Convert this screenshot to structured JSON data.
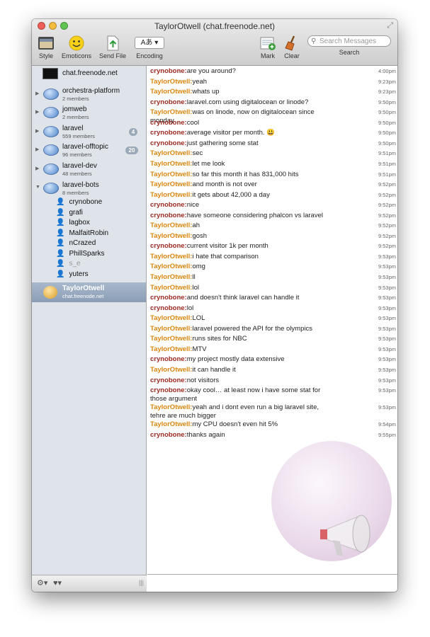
{
  "window": {
    "title": "TaylorOtwell (chat.freenode.net)"
  },
  "toolbar": {
    "style_label": "Style",
    "emoticons_label": "Emoticons",
    "send_file_label": "Send File",
    "encoding_label": "Encoding",
    "encoding_value": "Aあ ▾",
    "mark_label": "Mark",
    "clear_label": "Clear",
    "search_placeholder": "Search Messages",
    "search_label": "Search"
  },
  "sidebar": {
    "server": "chat.freenode.net",
    "channels": [
      {
        "name": "orchestra-platform",
        "members": "2 members",
        "badge": ""
      },
      {
        "name": "jomweb",
        "members": "2 members",
        "badge": ""
      },
      {
        "name": "laravel",
        "members": "559 members",
        "badge": "4"
      },
      {
        "name": "laravel-offtopic",
        "members": "96 members",
        "badge": "20"
      },
      {
        "name": "laravel-dev",
        "members": "48 members",
        "badge": ""
      },
      {
        "name": "laravel-bots",
        "members": "8 members",
        "badge": ""
      }
    ],
    "member_list": [
      "crynobone",
      "grafi",
      "lagbox",
      "MalfaitRobin",
      "nCrazed",
      "PhillSparks",
      "s_e",
      "yuters"
    ],
    "selected": {
      "name": "TaylorOtwell",
      "server": "chat.freenode.net"
    }
  },
  "messages": [
    {
      "nick": "crynobone:",
      "text": "are you around?",
      "time": "4:00pm"
    },
    {
      "nick": "TaylorOtwell:",
      "text": "yeah",
      "time": "9:23pm"
    },
    {
      "nick": "TaylorOtwell:",
      "text": "whats up",
      "time": "9:23pm"
    },
    {
      "nick": "crynobone:",
      "text": "laravel.com using digitalocean or linode?",
      "time": "9:50pm"
    },
    {
      "nick": "TaylorOtwell:",
      "text": "was on linode, now on digitalocean since monday",
      "time": "9:50pm"
    },
    {
      "nick": "crynobone:",
      "text": "cool",
      "time": "9:50pm"
    },
    {
      "nick": "crynobone:",
      "text": "average visitor per month.",
      "time": "9:50pm",
      "emoji": "😃"
    },
    {
      "nick": "crynobone:",
      "text": "just gathering some stat",
      "time": "9:50pm"
    },
    {
      "nick": "TaylorOtwell:",
      "text": "sec",
      "time": "9:51pm"
    },
    {
      "nick": "TaylorOtwell:",
      "text": "let me look",
      "time": "9:51pm"
    },
    {
      "nick": "TaylorOtwell:",
      "text": "so far this month it has 831,000 hits",
      "time": "9:51pm"
    },
    {
      "nick": "TaylorOtwell:",
      "text": "and month is not over",
      "time": "9:52pm"
    },
    {
      "nick": "TaylorOtwell:",
      "text": "it gets about 42,000 a day",
      "time": "9:52pm"
    },
    {
      "nick": "crynobone:",
      "text": "nice",
      "time": "9:52pm"
    },
    {
      "nick": "crynobone:",
      "text": "have someone considering phalcon vs laravel",
      "time": "9:52pm"
    },
    {
      "nick": "TaylorOtwell:",
      "text": "ah",
      "time": "9:52pm"
    },
    {
      "nick": "TaylorOtwell:",
      "text": "gosh",
      "time": "9:52pm"
    },
    {
      "nick": "crynobone:",
      "text": "current visitor 1k per month",
      "time": "9:52pm"
    },
    {
      "nick": "TaylorOtwell:",
      "text": "i hate that comparison",
      "time": "9:53pm"
    },
    {
      "nick": "TaylorOtwell:",
      "text": "omg",
      "time": "9:53pm"
    },
    {
      "nick": "TaylorOtwell:",
      "text": "ll",
      "time": "9:53pm"
    },
    {
      "nick": "TaylorOtwell:",
      "text": "lol",
      "time": "9:53pm"
    },
    {
      "nick": "crynobone:",
      "text": "and doesn't think laravel can handle it",
      "time": "9:53pm"
    },
    {
      "nick": "crynobone:",
      "text": "lol",
      "time": "9:53pm"
    },
    {
      "nick": "TaylorOtwell:",
      "text": "LOL",
      "time": "9:53pm"
    },
    {
      "nick": "TaylorOtwell:",
      "text": "laravel powered the API for the olympics",
      "time": "9:53pm"
    },
    {
      "nick": "TaylorOtwell:",
      "text": "runs sites for NBC",
      "time": "9:53pm"
    },
    {
      "nick": "TaylorOtwell:",
      "text": "MTV",
      "time": "9:53pm"
    },
    {
      "nick": "crynobone:",
      "text": "my project mostly data extensive",
      "time": "9:53pm"
    },
    {
      "nick": "TaylorOtwell:",
      "text": "it can handle it",
      "time": "9:53pm"
    },
    {
      "nick": "crynobone:",
      "text": "not visitors",
      "time": "9:53pm"
    },
    {
      "nick": "crynobone:",
      "text": "okay cool… at least now i have some stat for those argument",
      "time": "9:53pm"
    },
    {
      "nick": "TaylorOtwell:",
      "text": "yeah and i dont even run a big laravel site, tehre are much bigger",
      "time": "9:53pm"
    },
    {
      "nick": "TaylorOtwell:",
      "text": "my CPU doesn't even hit 5%",
      "time": "9:54pm"
    },
    {
      "nick": "crynobone:",
      "text": "thanks again",
      "time": "9:55pm"
    }
  ]
}
